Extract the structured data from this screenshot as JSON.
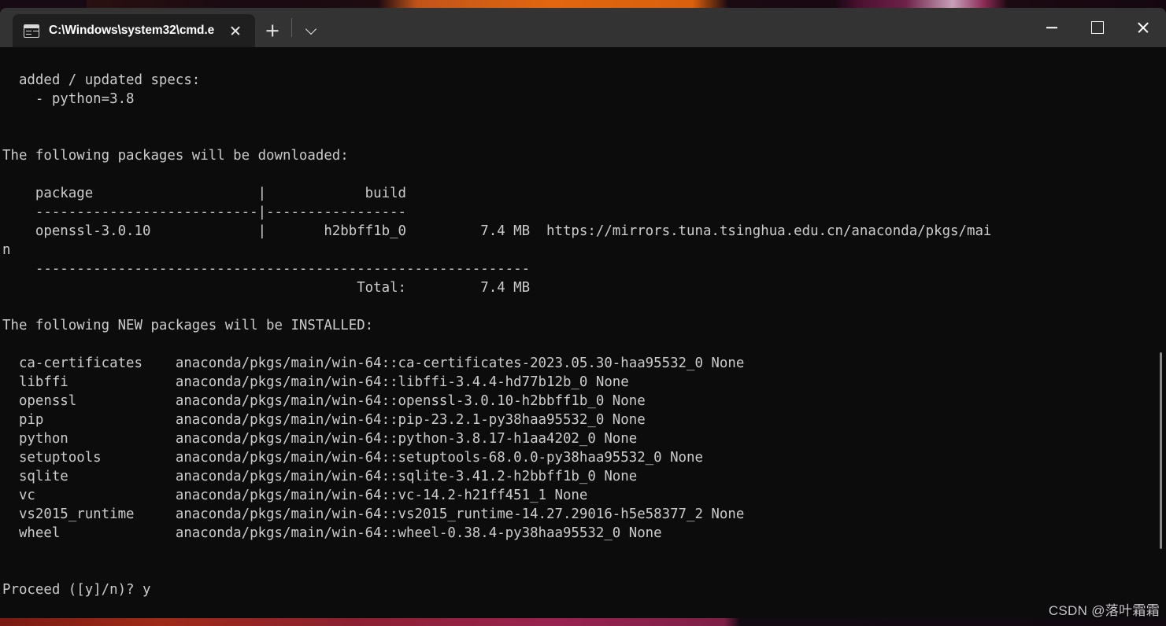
{
  "window": {
    "tab": {
      "title": "C:\\Windows\\system32\\cmd.e",
      "icon": "console-icon",
      "close_label": "×"
    },
    "new_tab_label": "+",
    "dropdown_label": "∨",
    "controls": {
      "minimize": "—",
      "maximize": "□",
      "close": "✕"
    }
  },
  "terminal": {
    "background_color": "#0c0c0c",
    "foreground_color": "#cccccc",
    "content": "  added / updated specs:\n    - python=3.8\n\n\nThe following packages will be downloaded:\n\n    package                    |            build\n    ---------------------------|-----------------\n    openssl-3.0.10             |       h2bbff1b_0         7.4 MB  https://mirrors.tuna.tsinghua.edu.cn/anaconda/pkgs/mai\nn\n    ------------------------------------------------------------\n                                           Total:         7.4 MB\n\nThe following NEW packages will be INSTALLED:\n\n  ca-certificates    anaconda/pkgs/main/win-64::ca-certificates-2023.05.30-haa95532_0 None\n  libffi             anaconda/pkgs/main/win-64::libffi-3.4.4-hd77b12b_0 None\n  openssl            anaconda/pkgs/main/win-64::openssl-3.0.10-h2bbff1b_0 None\n  pip                anaconda/pkgs/main/win-64::pip-23.2.1-py38haa95532_0 None\n  python             anaconda/pkgs/main/win-64::python-3.8.17-h1aa4202_0 None\n  setuptools         anaconda/pkgs/main/win-64::setuptools-68.0.0-py38haa95532_0 None\n  sqlite             anaconda/pkgs/main/win-64::sqlite-3.41.2-h2bbff1b_0 None\n  vc                 anaconda/pkgs/main/win-64::vc-14.2-h21ff451_1 None\n  vs2015_runtime     anaconda/pkgs/main/win-64::vs2015_runtime-14.27.29016-h5e58377_2 None\n  wheel              anaconda/pkgs/main/win-64::wheel-0.38.4-py38haa95532_0 None\n\n\nProceed ([y]/n)? y",
    "download_table": {
      "headers": [
        "package",
        "build"
      ],
      "rows": [
        {
          "package": "openssl-3.0.10",
          "build": "h2bbff1b_0",
          "size": "7.4 MB",
          "channel_url": "https://mirrors.tuna.tsinghua.edu.cn/anaconda/pkgs/main"
        }
      ],
      "total_label": "Total:",
      "total_size": "7.4 MB"
    },
    "install_list": [
      {
        "name": "ca-certificates",
        "spec": "anaconda/pkgs/main/win-64::ca-certificates-2023.05.30-haa95532_0",
        "channel": "None"
      },
      {
        "name": "libffi",
        "spec": "anaconda/pkgs/main/win-64::libffi-3.4.4-hd77b12b_0",
        "channel": "None"
      },
      {
        "name": "openssl",
        "spec": "anaconda/pkgs/main/win-64::openssl-3.0.10-h2bbff1b_0",
        "channel": "None"
      },
      {
        "name": "pip",
        "spec": "anaconda/pkgs/main/win-64::pip-23.2.1-py38haa95532_0",
        "channel": "None"
      },
      {
        "name": "python",
        "spec": "anaconda/pkgs/main/win-64::python-3.8.17-h1aa4202_0",
        "channel": "None"
      },
      {
        "name": "setuptools",
        "spec": "anaconda/pkgs/main/win-64::setuptools-68.0.0-py38haa95532_0",
        "channel": "None"
      },
      {
        "name": "sqlite",
        "spec": "anaconda/pkgs/main/win-64::sqlite-3.41.2-h2bbff1b_0",
        "channel": "None"
      },
      {
        "name": "vc",
        "spec": "anaconda/pkgs/main/win-64::vc-14.2-h21ff451_1",
        "channel": "None"
      },
      {
        "name": "vs2015_runtime",
        "spec": "anaconda/pkgs/main/win-64::vs2015_runtime-14.27.29016-h5e58377_2",
        "channel": "None"
      },
      {
        "name": "wheel",
        "spec": "anaconda/pkgs/main/win-64::wheel-0.38.4-py38haa95532_0",
        "channel": "None"
      }
    ],
    "specs": {
      "heading": "added / updated specs:",
      "items": [
        "- python=3.8"
      ]
    },
    "headings": {
      "download": "The following packages will be downloaded:",
      "install": "The following NEW packages will be INSTALLED:"
    },
    "prompt": "Proceed ([y]/n)?",
    "prompt_answer": "y"
  },
  "watermark": {
    "text": "CSDN @落叶霜霜"
  }
}
